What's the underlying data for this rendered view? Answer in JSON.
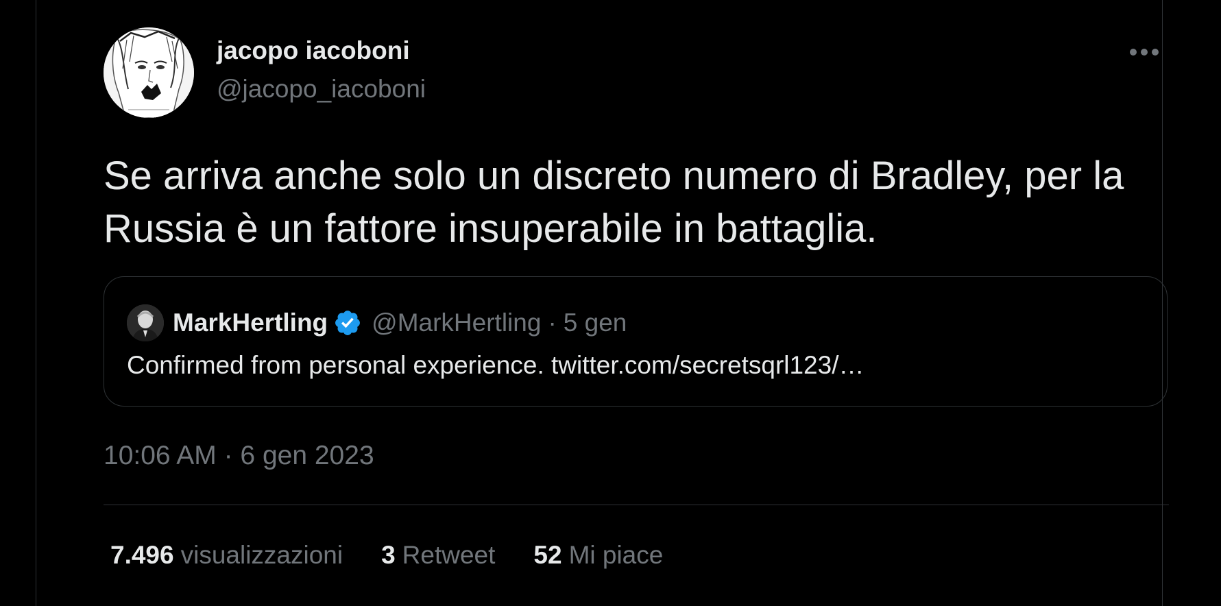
{
  "tweet": {
    "author_name": "jacopo iacoboni",
    "author_handle": "@jacopo_iacoboni",
    "text": "Se arriva anche solo un discreto numero di Bradley, per la Russia è un fattore insuperabile in battaglia.",
    "more_icon": "ellipsis-icon",
    "timestamp": "10:06 AM · 6 gen 2023"
  },
  "quote": {
    "author_name": "MarkHertling",
    "verified_icon": "verified-badge-icon",
    "author_handle": "@MarkHertling",
    "separator": "·",
    "time": "5 gen",
    "text": "Confirmed from personal experience. twitter.com/secretsqrl123/…"
  },
  "stats": [
    {
      "count": "7.496",
      "label": "visualizzazioni"
    },
    {
      "count": "3",
      "label": "Retweet"
    },
    {
      "count": "52",
      "label": "Mi piace"
    }
  ],
  "colors": {
    "background": "#000000",
    "text_primary": "#e7e9ea",
    "text_secondary": "#71767b",
    "border": "#2f3336",
    "verified_blue": "#1d9bf0"
  }
}
